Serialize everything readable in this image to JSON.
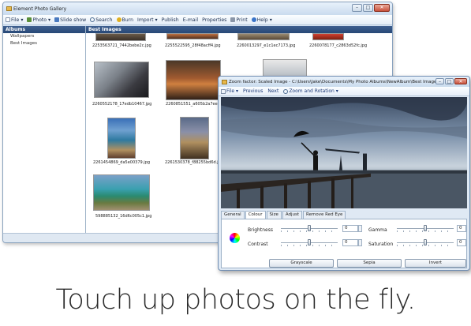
{
  "main_window": {
    "title": "Element Photo Gallery",
    "toolbar": [
      {
        "label": "File ▾",
        "icon": "file-icon"
      },
      {
        "label": "Photo ▾",
        "icon": "photo-icon"
      },
      {
        "label": "Slide show",
        "icon": "slideshow-icon"
      },
      {
        "label": "Search",
        "icon": "search-icon"
      },
      {
        "label": "Burn",
        "icon": "burn-icon"
      },
      {
        "label": "Import ▾",
        "icon": ""
      },
      {
        "label": "Publish",
        "icon": ""
      },
      {
        "label": "E-mail",
        "icon": ""
      },
      {
        "label": "Properties",
        "icon": ""
      },
      {
        "label": "Print",
        "icon": "print-icon"
      },
      {
        "label": "Help ▾",
        "icon": "help-icon"
      }
    ],
    "albums_header": "Albums",
    "albums": [
      "Wallpapers",
      "Best Images"
    ],
    "gallery_header": "Best Images",
    "thumbnails": [
      "2253563721_7442bebe2c.jpg",
      "2255522595_28f48acff4.jpg",
      "2260013297_e1c1ec7173.jpg",
      "2260078177_c2863d52fc.jpg",
      "2260552178_17edb10467.jpg",
      "2260851551_a605b2a7ee.jpg",
      "2261454869_da5e00379.jpg",
      "2261530378_f88255bd6d.jpg",
      "598885132_16d6c005c1.jpg"
    ]
  },
  "editor_window": {
    "title": "Zoom factor: Scaled Image - C:\\Users\\Jake\\Documents\\My Photo Albums\\NewAlbum\\Best Images...",
    "toolbar": [
      "File ▾",
      "Previous",
      "Next",
      "Zoom and Rotation ▾"
    ],
    "tabs": [
      "General",
      "Colour",
      "Size",
      "Adjust",
      "Remove Red Eye"
    ],
    "active_tab": "Colour",
    "controls": {
      "brightness": {
        "label": "Brightness",
        "value": "0",
        "level": 0.5
      },
      "contrast": {
        "label": "Contrast",
        "value": "0",
        "level": 0.5
      },
      "gamma": {
        "label": "Gamma",
        "value": "0",
        "level": 0.5
      },
      "saturation": {
        "label": "Saturation",
        "value": "0",
        "level": 0.5
      }
    },
    "buttons": [
      "Grayscale",
      "Sepia",
      "Invert"
    ]
  },
  "tagline": "Touch up photos on the fly.",
  "colors": {
    "header": "#2f5283",
    "accent": "#1c3a78"
  }
}
